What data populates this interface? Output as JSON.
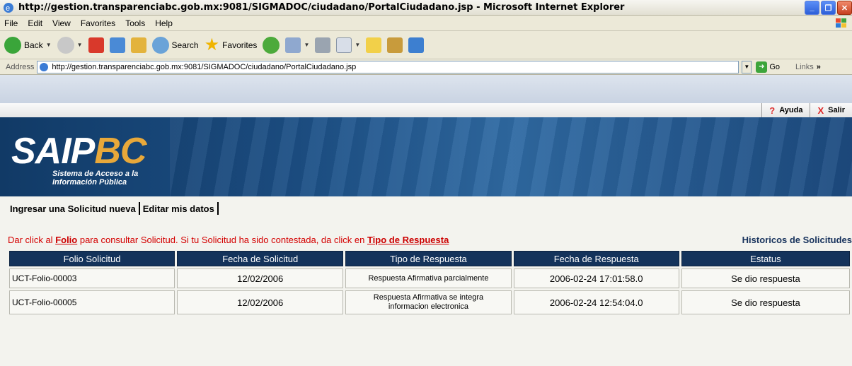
{
  "window": {
    "title": "http://gestion.transparenciabc.gob.mx:9081/SIGMADOC/ciudadano/PortalCiudadano.jsp - Microsoft Internet Explorer"
  },
  "menu": [
    "File",
    "Edit",
    "View",
    "Favorites",
    "Tools",
    "Help"
  ],
  "toolbar": {
    "back": "Back",
    "search": "Search",
    "favorites": "Favorites"
  },
  "address": {
    "label": "Address",
    "url": "http://gestion.transparenciabc.gob.mx:9081/SIGMADOC/ciudadano/PortalCiudadano.jsp",
    "go": "Go",
    "links": "Links"
  },
  "page": {
    "ayuda": "Ayuda",
    "salir": "Salir",
    "logo_main": "SAIP",
    "logo_accent": "BC",
    "logo_sub1": "Sistema de Acceso a la",
    "logo_sub2": "Información Pública",
    "nav_new": "Ingresar una Solicitud nueva",
    "nav_edit": "Editar mis datos",
    "instr_1": "Dar click al ",
    "instr_folio": "Folio",
    "instr_2": " para consultar Solicitud. Si tu Solicitud ha sido contestada, da click en ",
    "instr_tipo": "Tipo de Respuesta",
    "historicos": "Historicos de Solicitudes"
  },
  "table": {
    "headers": [
      "Folio Solicitud",
      "Fecha de Solicitud",
      "Tipo de Respuesta",
      "Fecha de Respuesta",
      "Estatus"
    ],
    "rows": [
      {
        "folio": "UCT-Folio-00003",
        "fecha": "12/02/2006",
        "tipo": "Respuesta Afirmativa parcialmente",
        "tipo2": "",
        "fecha_resp": "2006-02-24 17:01:58.0",
        "estatus": "Se dio respuesta"
      },
      {
        "folio": "UCT-Folio-00005",
        "fecha": "12/02/2006",
        "tipo": "Respuesta Afirmativa se integra",
        "tipo2": "informacion electronica",
        "fecha_resp": "2006-02-24 12:54:04.0",
        "estatus": "Se dio respuesta"
      }
    ]
  }
}
